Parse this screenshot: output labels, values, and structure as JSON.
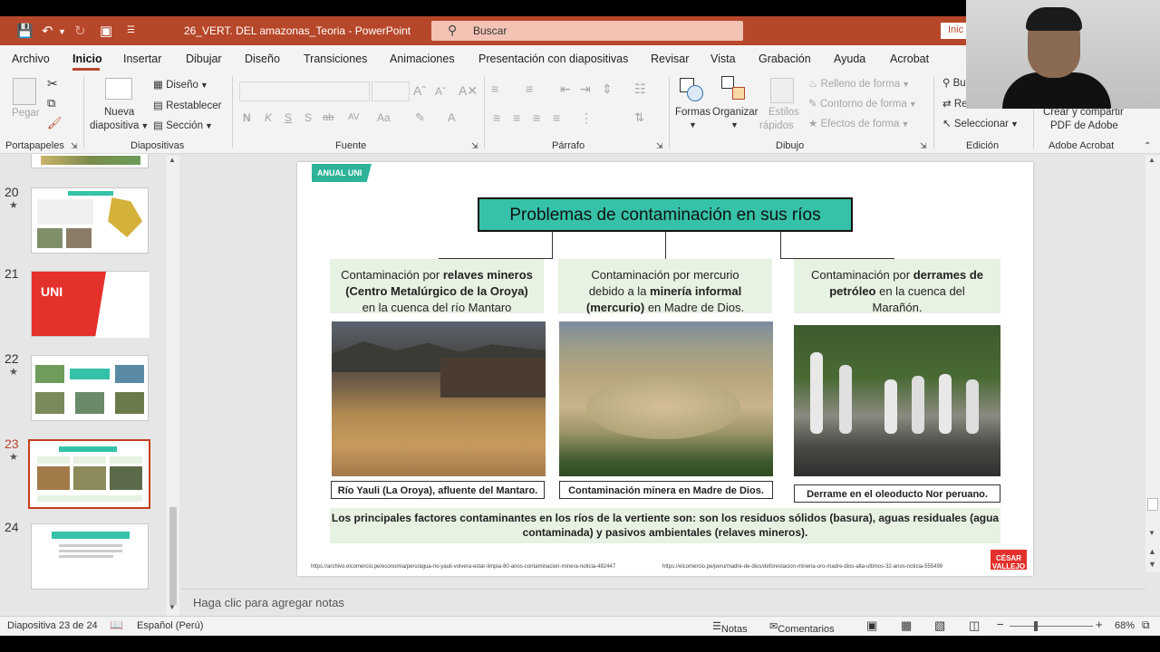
{
  "titlebar": {
    "doc_title": "26_VERT. DEL amazonas_Teoria  -  PowerPoint",
    "search_placeholder": "Buscar",
    "signin": "Inic"
  },
  "menu": [
    "Archivo",
    "Inicio",
    "Insertar",
    "Dibujar",
    "Diseño",
    "Transiciones",
    "Animaciones",
    "Presentación con diapositivas",
    "Revisar",
    "Vista",
    "Grabación",
    "Ayuda",
    "Acrobat"
  ],
  "ribbon": {
    "paste": "Pegar",
    "new_slide_1": "Nueva",
    "new_slide_2": "diapositiva",
    "layout": "Diseño",
    "reset": "Restablecer",
    "section": "Sección",
    "formas": "Formas",
    "organizar": "Organizar",
    "estilos_1": "Estilos",
    "estilos_2": "rápidos",
    "relleno": "Relleno de forma",
    "contorno": "Contorno de forma",
    "efectos": "Efectos de forma",
    "buscar": "Bu",
    "reemplazar": "Re",
    "seleccionar": "Seleccionar",
    "adobe_1": "Crear y compartir",
    "adobe_2": "PDF de Adobe",
    "groups": {
      "portapapeles": "Portapapeles",
      "diapositivas": "Diapositivas",
      "fuente": "Fuente",
      "parrafo": "Párrafo",
      "dibujo": "Dibujo",
      "edicion": "Edición",
      "adobe": "Adobe Acrobat"
    },
    "font_buttons": [
      "N",
      "K",
      "S",
      "S",
      "ab",
      "AV",
      "Aa"
    ]
  },
  "thumbnails": [
    {
      "num": "20",
      "star": "★"
    },
    {
      "num": "21",
      "star": ""
    },
    {
      "num": "22",
      "star": "★"
    },
    {
      "num": "23",
      "star": "★"
    },
    {
      "num": "24",
      "star": ""
    }
  ],
  "slide": {
    "badge": "ANUAL UNI",
    "title": "Problemas de contaminación en sus ríos",
    "col1": {
      "p1": "Contaminación por ",
      "b1": "relaves mineros",
      "b2": "(Centro Metalúrgico de la Oroya)",
      "p2": "en la cuenca del río Mantaro"
    },
    "col2": {
      "p1": "Contaminación por mercurio",
      "p2": "debido a la ",
      "b1": "minería informal",
      "b2": "(mercurio)",
      "p3": " en Madre de Dios."
    },
    "col3": {
      "p1": "Contaminación por ",
      "b1": "derrames de",
      "b2": "petróleo",
      "p2": " en la cuenca del",
      "p3": "Marañón."
    },
    "cap1": "Río Yauli (La Oroya), afluente del Mantaro.",
    "cap2": "Contaminación minera en Madre de Dios.",
    "cap3": "Derrame en el oleoducto Nor peruano.",
    "summary": "Los principales factores contaminantes en los ríos de la vertiente son: son los residuos sólidos (basura), aguas residuales (agua contaminada) y pasivos ambientales (relaves mineros).",
    "src1": "https://archivo.elcomercio.pe/economia/peru/agua-rio-yauli-volvera-estar-limpia-80-anos-contaminacion-minera-noticia-482447",
    "src2": "https://elcomercio.pe/peru/madre-de-dios/deforestacion-mineria-oro-madre-dios-alta-ultimos-32-anos-noticia-555499",
    "logo": "CÉSAR VALLEJO"
  },
  "notes_placeholder": "Haga clic para agregar notas",
  "status": {
    "slide_info": "Diapositiva 23 de 24",
    "language": "Español (Perú)",
    "notes": "Notas",
    "comments": "Comentarios",
    "zoom": "68%"
  },
  "colors": {
    "accent": "#b7472a",
    "teal": "#35c2a8",
    "green_box": "#e7f2e2"
  }
}
